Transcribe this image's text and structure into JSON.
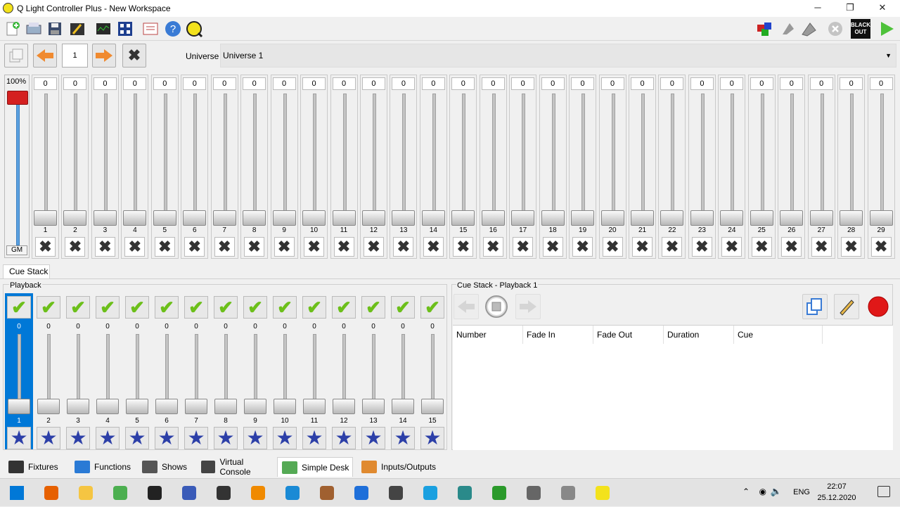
{
  "window": {
    "title": "Q Light Controller Plus - New Workspace",
    "minimize": "─",
    "maximize": "❐",
    "close": "✕"
  },
  "toolbar": {
    "left_icons": [
      "new-workspace-icon",
      "open-icon",
      "save-icon",
      "edit-mode-icon",
      "monitor-icon",
      "address-tool-icon",
      "dump-dmx-icon",
      "help-icon",
      "about-icon"
    ],
    "right_icons": [
      "live-edit-icon",
      "panic-icon",
      "stop-all-icon",
      "disabled-icon",
      "blackout-icon",
      "play-icon"
    ],
    "blackout_label": "BLACK OUT"
  },
  "simple_desk": {
    "page": "1",
    "universe_label": "Universe",
    "universe_value": "Universe 1",
    "grand_master": {
      "percent": "100%",
      "label": "GM"
    },
    "channels": [
      {
        "value": "0",
        "number": "1"
      },
      {
        "value": "0",
        "number": "2"
      },
      {
        "value": "0",
        "number": "3"
      },
      {
        "value": "0",
        "number": "4"
      },
      {
        "value": "0",
        "number": "5"
      },
      {
        "value": "0",
        "number": "6"
      },
      {
        "value": "0",
        "number": "7"
      },
      {
        "value": "0",
        "number": "8"
      },
      {
        "value": "0",
        "number": "9"
      },
      {
        "value": "0",
        "number": "10"
      },
      {
        "value": "0",
        "number": "11"
      },
      {
        "value": "0",
        "number": "12"
      },
      {
        "value": "0",
        "number": "13"
      },
      {
        "value": "0",
        "number": "14"
      },
      {
        "value": "0",
        "number": "15"
      },
      {
        "value": "0",
        "number": "16"
      },
      {
        "value": "0",
        "number": "17"
      },
      {
        "value": "0",
        "number": "18"
      },
      {
        "value": "0",
        "number": "19"
      },
      {
        "value": "0",
        "number": "20"
      },
      {
        "value": "0",
        "number": "21"
      },
      {
        "value": "0",
        "number": "22"
      },
      {
        "value": "0",
        "number": "23"
      },
      {
        "value": "0",
        "number": "24"
      },
      {
        "value": "0",
        "number": "25"
      },
      {
        "value": "0",
        "number": "26"
      },
      {
        "value": "0",
        "number": "27"
      },
      {
        "value": "0",
        "number": "28"
      },
      {
        "value": "0",
        "number": "29"
      }
    ]
  },
  "cue_stack_tab": "Cue Stack",
  "playback": {
    "title": "Playback",
    "items": [
      {
        "value": "0",
        "number": "1",
        "selected": true
      },
      {
        "value": "0",
        "number": "2"
      },
      {
        "value": "0",
        "number": "3"
      },
      {
        "value": "0",
        "number": "4"
      },
      {
        "value": "0",
        "number": "5"
      },
      {
        "value": "0",
        "number": "6"
      },
      {
        "value": "0",
        "number": "7"
      },
      {
        "value": "0",
        "number": "8"
      },
      {
        "value": "0",
        "number": "9"
      },
      {
        "value": "0",
        "number": "10"
      },
      {
        "value": "0",
        "number": "11"
      },
      {
        "value": "0",
        "number": "12"
      },
      {
        "value": "0",
        "number": "13"
      },
      {
        "value": "0",
        "number": "14"
      },
      {
        "value": "0",
        "number": "15"
      }
    ]
  },
  "cue_stack": {
    "title": "Cue Stack - Playback 1",
    "columns": [
      "Number",
      "Fade In",
      "Fade Out",
      "Duration",
      "Cue"
    ]
  },
  "bottom_tabs": [
    {
      "label": "Fixtures",
      "icon": "fixtures-icon"
    },
    {
      "label": "Functions",
      "icon": "functions-icon"
    },
    {
      "label": "Shows",
      "icon": "shows-icon"
    },
    {
      "label": "Virtual Console",
      "icon": "virtual-console-icon"
    },
    {
      "label": "Simple Desk",
      "icon": "simple-desk-icon",
      "active": true
    },
    {
      "label": "Inputs/Outputs",
      "icon": "inputs-outputs-icon"
    }
  ],
  "taskbar": {
    "apps": [
      "windows-start-icon",
      "firefox-icon",
      "file-explorer-icon",
      "notepad-icon",
      "terminal-icon",
      "network-icon",
      "obs-icon",
      "vlc-icon",
      "virtualbox-icon",
      "media-icon",
      "malwarebytes-icon",
      "bv-icon",
      "ccleaner-icon",
      "audio-icon",
      "game-icon",
      "settings-icon",
      "server-icon",
      "qlc-icon"
    ],
    "tray": {
      "lang": "ENG",
      "time": "22:07",
      "date": "25.12.2020"
    }
  },
  "colors": {
    "selected": "#0078d7",
    "gm_handle": "#d42020",
    "check": "#6cbf1a",
    "star": "#2c3fa8"
  }
}
